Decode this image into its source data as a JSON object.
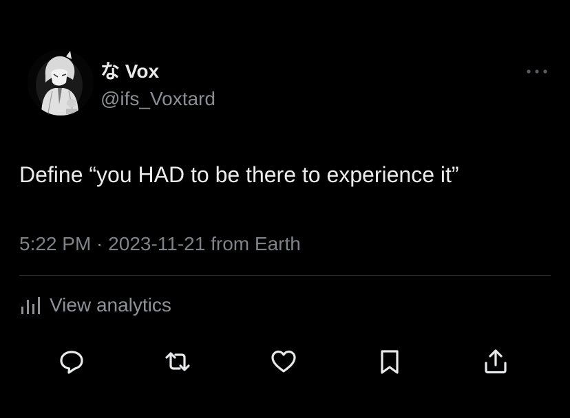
{
  "tweet": {
    "author": {
      "display_name": "な Vox",
      "handle": "@ifs_Voxtard"
    },
    "text": "Define “you HAD to be there to experience it”",
    "time": "5:22 PM",
    "separator": " · ",
    "date": "2023-11-21",
    "source": " from Earth"
  },
  "analytics": {
    "label": "View analytics",
    "icon": "bar-chart-icon"
  },
  "actions": [
    {
      "name": "reply",
      "icon": "reply-icon"
    },
    {
      "name": "retweet",
      "icon": "retweet-icon"
    },
    {
      "name": "like",
      "icon": "heart-icon"
    },
    {
      "name": "bookmark",
      "icon": "bookmark-icon"
    },
    {
      "name": "share",
      "icon": "share-icon"
    }
  ],
  "colors": {
    "background": "#000000",
    "primary_text": "#ececec",
    "secondary_text": "#8b8f93",
    "divider": "#2b2d30",
    "icon": "#e7e9ea"
  }
}
